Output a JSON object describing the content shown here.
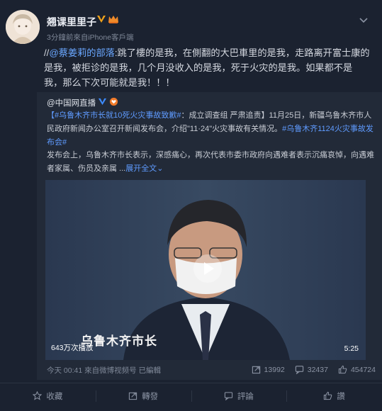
{
  "header": {
    "username": "翘课里里子",
    "meta": "3分鐘前來自iPhone客戶端"
  },
  "post": {
    "prefix": "//",
    "mention": "@蔡姜莉的部落",
    "text": ":跳了樓的是我，在側翻的大巴車里的是我，走路离开富士康的是我，被拒诊的是我，几个月没收入的是我，死于火灾的是我。如果都不是我，那么下次可能就是我！！！"
  },
  "repost": {
    "author": "@中国网直播",
    "tag1": "【#乌鲁木齐市长就10死火灾事故致歉#",
    "text1": "：成立调查组 严肃追责】11月25日，新疆乌鲁木齐市人民政府新闻办公室召开新闻发布会，介绍\"11·24\"火灾事故有关情况。",
    "tag2": "#乌鲁木齐1124火灾事故发布会#",
    "text2": "发布会上，乌鲁木齐市长表示，深感痛心，再次代表市委市政府向遇难者表示沉痛哀悼，向遇难者家属、伤员及亲属 ...",
    "expand_label": "展开全文",
    "video": {
      "views": "643万次播放",
      "duration": "5:25",
      "caption": "乌鲁木齐市长"
    },
    "footer": {
      "time": "今天 00:41 來自微博视频号",
      "edited": "已編輯",
      "reposts": "13992",
      "comments": "32437",
      "likes": "454724"
    }
  },
  "actions": {
    "favorite": "收藏",
    "repost": "轉發",
    "comment": "評論",
    "like": "讚"
  },
  "colors": {
    "background": "#1b2230",
    "repost_bg": "#222a38",
    "link": "#6aa7ff",
    "muted": "#7f8898"
  }
}
